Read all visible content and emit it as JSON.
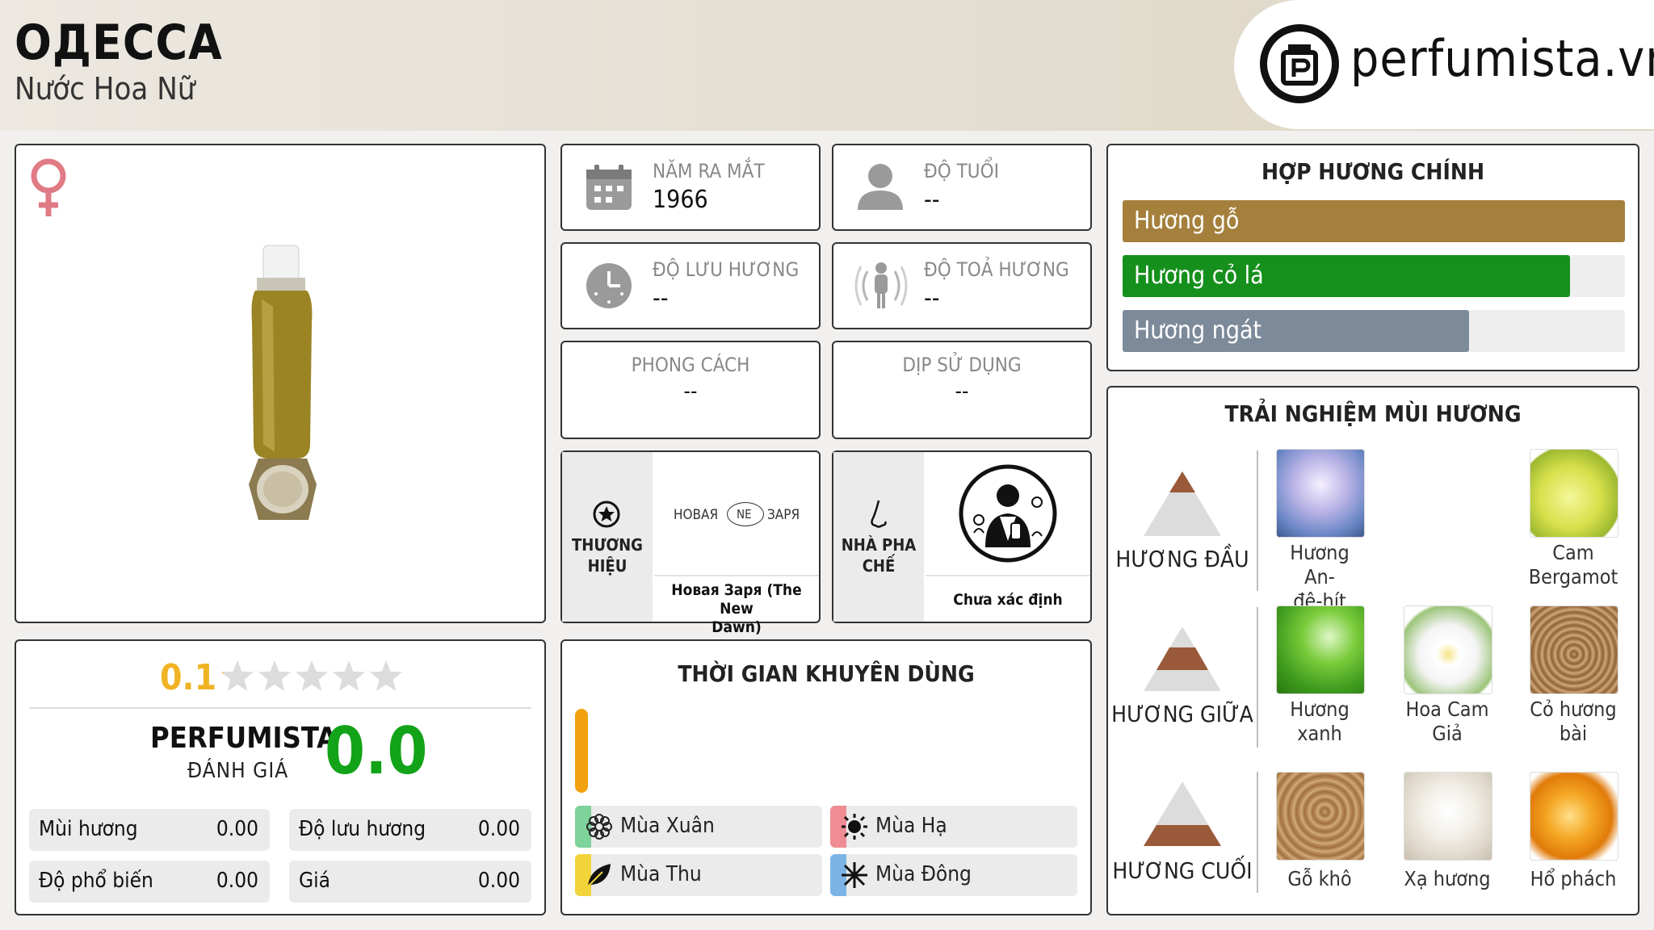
{
  "header": {
    "title": "ОДЕССА",
    "subtitle": "Nước Hoa Nữ",
    "logo_text": "perfumista.vn"
  },
  "product": {
    "gender_icon": "female-symbol-icon",
    "image": "perfume-bottle"
  },
  "info": {
    "launch_year": {
      "label": "NĂM RA MẮT",
      "value": "1966"
    },
    "age": {
      "label": "ĐỘ TUỔI",
      "value": "--"
    },
    "longevity": {
      "label": "ĐỘ LƯU HƯƠNG",
      "value": "--"
    },
    "sillage": {
      "label": "ĐỘ TOẢ HƯƠNG",
      "value": "--"
    },
    "style": {
      "label": "PHONG CÁCH",
      "value": "--"
    },
    "occasion": {
      "label": "DỊP SỬ DỤNG",
      "value": "--"
    }
  },
  "brand": {
    "label_line1": "THƯƠNG",
    "label_line2": "HIỆU",
    "logo_left": "НОВАЯ",
    "logo_mid": "NE",
    "logo_right": "ЗАРЯ",
    "name_line1": "Новая Заря (The New",
    "name_line2": "Dawn)"
  },
  "perfumer": {
    "label_line1": "NHÀ PHA",
    "label_line2": "CHẾ",
    "name": "Chưa xác định"
  },
  "accords": {
    "title": "HỢP HƯƠNG CHÍNH",
    "items": [
      {
        "label": "Hương gỗ",
        "fill": 1.0,
        "color": "#a5803c"
      },
      {
        "label": "Hương cỏ lá",
        "fill": 0.89,
        "color": "#15901c"
      },
      {
        "label": "Hương ngát",
        "fill": 0.69,
        "color": "#7c8a99"
      }
    ]
  },
  "notes": {
    "title": "TRẢI NGHIỆM MÙI HƯƠNG",
    "top": {
      "label": "HƯƠNG ĐẦU",
      "items": [
        {
          "line1": "Hương An-",
          "line2": "đê-hít"
        },
        {
          "line1": "Cam",
          "line2": "Bergamot"
        }
      ]
    },
    "middle": {
      "label": "HƯƠNG GIỮA",
      "items": [
        {
          "line1": "Hương xanh",
          "line2": ""
        },
        {
          "line1": "Hoa Cam",
          "line2": "Giả"
        },
        {
          "line1": "Cỏ hương",
          "line2": "bài"
        }
      ]
    },
    "base": {
      "label": "HƯƠNG CUỐI",
      "items": [
        {
          "line1": "Gỗ khô",
          "line2": ""
        },
        {
          "line1": "Xạ hương",
          "line2": ""
        },
        {
          "line1": "Hổ phách",
          "line2": ""
        }
      ]
    }
  },
  "rating": {
    "score": "0.1",
    "stars": 0.02,
    "perfumista_label": "PERFUMISTA",
    "review_label": "ĐÁNH GIÁ",
    "perfumista_score": "0.0",
    "metrics": [
      {
        "label": "Mùi hương",
        "value": "0.00"
      },
      {
        "label": "Độ lưu hương",
        "value": "0.00"
      },
      {
        "label": "Độ phổ biến",
        "value": "0.00"
      },
      {
        "label": "Giá",
        "value": "0.00"
      }
    ]
  },
  "seasons": {
    "title": "THỜI GIAN KHUYÊN DÙNG",
    "day_level": 1.0,
    "items": [
      {
        "label": "Mùa Xuân",
        "color": "#7dd39a"
      },
      {
        "label": "Mùa Hạ",
        "color": "#f08c94"
      },
      {
        "label": "Mùa Thu",
        "color": "#f2d43a"
      },
      {
        "label": "Mùa Đông",
        "color": "#7db4e6"
      }
    ]
  }
}
